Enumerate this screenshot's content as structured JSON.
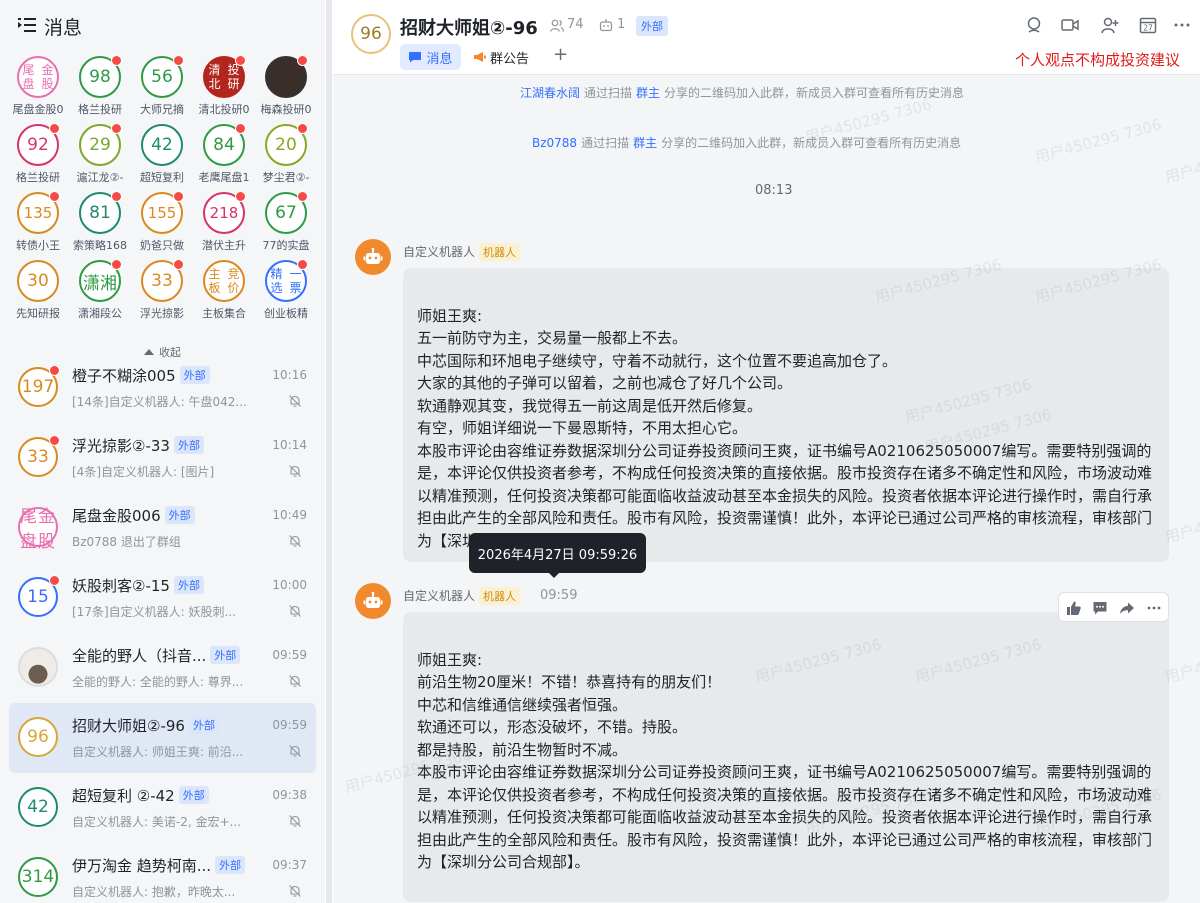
{
  "left": {
    "title": "消息",
    "collapse_label": "收起",
    "apps": [
      {
        "avatar": "尾盘\n金股",
        "label": "尾盘金股0",
        "color": "#e86fb0",
        "dot": false
      },
      {
        "avatar": "98",
        "label": "格兰投研",
        "color": "#2e9a46",
        "dot": true
      },
      {
        "avatar": "56",
        "label": "大师兄摘",
        "color": "#2e9a46",
        "dot": true
      },
      {
        "avatar": "清北\n投研",
        "label": "清北投研0",
        "color": "#b3261e",
        "dot": true
      },
      {
        "avatar": "",
        "label": "梅森投研0",
        "color": "#333333",
        "dot": true
      },
      {
        "avatar": "92",
        "label": "格兰投研",
        "color": "#d4336c",
        "dot": true
      },
      {
        "avatar": "29",
        "label": "滬江龙②-",
        "color": "#7ba82c",
        "dot": true
      },
      {
        "avatar": "42",
        "label": "超短复利",
        "color": "#1f8a70",
        "dot": false
      },
      {
        "avatar": "84",
        "label": "老鹰尾盘1",
        "color": "#2e9a46",
        "dot": true
      },
      {
        "avatar": "20",
        "label": "梦尘君②-",
        "color": "#8aa623",
        "dot": true
      },
      {
        "avatar": "135",
        "label": "转债小王",
        "color": "#d98a1f",
        "dot": true
      },
      {
        "avatar": "81",
        "label": "索策略168",
        "color": "#1f8a70",
        "dot": true
      },
      {
        "avatar": "155",
        "label": "奶爸只做",
        "color": "#d98a1f",
        "dot": true
      },
      {
        "avatar": "218",
        "label": "潜伏主升",
        "color": "#d4336c",
        "dot": true
      },
      {
        "avatar": "67",
        "label": "77的实盘",
        "color": "#2e9a46",
        "dot": true
      },
      {
        "avatar": "30",
        "label": "先知研报",
        "color": "#d98a1f",
        "dot": false
      },
      {
        "avatar": "潇湘",
        "label": "潇湘段公",
        "color": "#2e9a46",
        "dot": true
      },
      {
        "avatar": "33",
        "label": "浮光掠影",
        "color": "#d98a1f",
        "dot": true
      },
      {
        "avatar": "主板\n竞价",
        "label": "主板集合",
        "color": "#d98a1f",
        "dot": false
      },
      {
        "avatar": "精选\n一票",
        "label": "创业板精",
        "color": "#3370ff",
        "dot": true
      }
    ],
    "conversations": [
      {
        "avatar": "197",
        "name": "橙子不糊涂005",
        "tag": "外部",
        "time": "10:16",
        "preview": "[14条]自定义机器人: 午盘042...",
        "color": "#d98a1f",
        "dot": true,
        "selected": false
      },
      {
        "avatar": "33",
        "name": "浮光掠影②-33",
        "tag": "外部",
        "time": "10:14",
        "preview": "[4条]自定义机器人: [图片]",
        "color": "#d98a1f",
        "dot": true,
        "selected": false
      },
      {
        "avatar": "尾盘\n金股",
        "name": "尾盘金股006",
        "tag": "外部",
        "time": "10:49",
        "preview": "Bz0788 退出了群组",
        "color": "#e86fb0",
        "dot": false,
        "selected": false
      },
      {
        "avatar": "15",
        "name": "妖股刺客②-15",
        "tag": "外部",
        "time": "10:00",
        "preview": "[17条]自定义机器人: 妖股刺...",
        "color": "#3370ff",
        "dot": true,
        "selected": false
      },
      {
        "avatar": "",
        "name": "全能的野人（抖音...",
        "tag": "外部",
        "time": "09:59",
        "preview": "全能的野人: 全能的野人: 尊界...",
        "color": "#888888",
        "dot": false,
        "selected": false
      },
      {
        "avatar": "96",
        "name": "招财大师姐②-96",
        "tag": "外部",
        "time": "09:59",
        "preview": "自定义机器人: 师姐王爽: 前沿...",
        "color": "#d9a43a",
        "dot": false,
        "selected": true
      },
      {
        "avatar": "42",
        "name": "超短复利 ②-42",
        "tag": "外部",
        "time": "09:38",
        "preview": "自定义机器人: 美诺-2, 金宏+...",
        "color": "#1f8a70",
        "dot": false,
        "selected": false
      },
      {
        "avatar": "314",
        "name": "伊万淘金 趋势柯南...",
        "tag": "外部",
        "time": "09:37",
        "preview": "自定义机器人: 抱歉，昨晚太...",
        "color": "#2e9a46",
        "dot": false,
        "selected": false
      }
    ]
  },
  "chat": {
    "avatar": "96",
    "title": "招财大师姐②-96",
    "member_count": "74",
    "bot_count": "1",
    "ext_tag": "外部",
    "tab_messages": "消息",
    "tab_notice": "群公告",
    "tab_add": "+",
    "disclaimer": "个人观点不构成投资建议",
    "calendar_day": "27",
    "system_messages": [
      {
        "user": "江湖春水阔",
        "mid": "通过扫描",
        "owner": "群主",
        "rest": "分享的二维码加入此群，新成员入群可查看所有历史消息"
      },
      {
        "user": "Bz0788",
        "mid": "通过扫描",
        "owner": "群主",
        "rest": "分享的二维码加入此群，新成员入群可查看所有历史消息"
      }
    ],
    "timestamp": "08:13",
    "messages": [
      {
        "sender": "自定义机器人",
        "bot_tag": "机器人",
        "time": "",
        "text": "\n师姐王爽:\n五一前防守为主，交易量一般都上不去。\n中芯国际和环旭电子继续守，守着不动就行，这个位置不要追高加仓了。\n大家的其他的子弹可以留着，之前也减仓了好几个公司。\n软通静观其变，我觉得五一前这周是低开然后修复。\n有空，师姐详细说一下曼恩斯特，不用太担心它。\n本股市评论由容维证券数据深圳分公司证券投资顾问王爽，证书编号A0210625050007编写。需要特别强调的是，本评论仅供投资者参考，不构成任何投资决策的直接依据。股市投资存在诸多不确定性和风险，市场波动难以精准预测，任何投资决策都可能面临收益波动甚至本金损失的风险。投资者依据本评论进行操作时，需自行承担由此产生的全部风险和责任。股市有风险，投资需谨慎！此外，本评论已通过公司严格的审核流程，审核部门为【深圳分公司合规部】。"
      },
      {
        "sender": "自定义机器人",
        "bot_tag": "机器人",
        "time": "09:59",
        "text": "\n师姐王爽:\n前沿生物20厘米！不错！恭喜持有的朋友们！\n中芯和信维通信继续强者恒强。\n软通还可以，形态没破坏，不错。持股。\n都是持股，前沿生物暂时不减。\n本股市评论由容维证券数据深圳分公司证券投资顾问王爽，证书编号A0210625050007编写。需要特别强调的是，本评论仅供投资者参考，不构成任何投资决策的直接依据。股市投资存在诸多不确定性和风险，市场波动难以精准预测，任何投资决策都可能面临收益波动甚至本金损失的风险。投资者依据本评论进行操作时，需自行承担由此产生的全部风险和责任。股市有风险，投资需谨慎！此外，本评论已通过公司严格的审核流程，审核部门为【深圳分公司合规部】。"
      }
    ],
    "tooltip": "2026年4月27日 09:59:26",
    "watermark": "用户450295 7306"
  }
}
